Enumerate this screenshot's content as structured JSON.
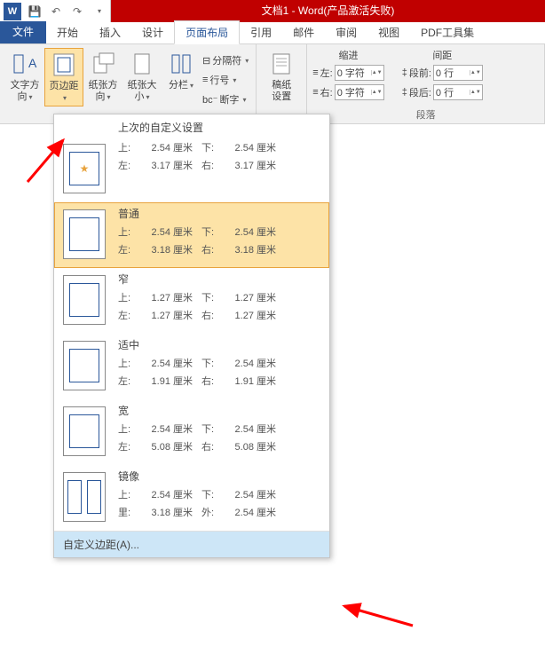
{
  "title": "文档1 - Word(产品激活失败)",
  "qat": {
    "save": "保存",
    "undo": "↶",
    "redo": "↷"
  },
  "tabs": {
    "file": "文件",
    "items": [
      "开始",
      "插入",
      "设计",
      "页面布局",
      "引用",
      "邮件",
      "审阅",
      "视图",
      "PDF工具集"
    ],
    "active_index": 3
  },
  "ribbon": {
    "text_dir": "文字方向",
    "margins": "页边距",
    "orientation": "纸张方向",
    "size": "纸张大小",
    "columns": "分栏",
    "breaks": "分隔符",
    "line_num": "行号",
    "hyphen": "断字",
    "draft": "稿纸",
    "draft2": "设置",
    "indent_group": "缩进",
    "spacing_group": "间距",
    "indent_left": "左:",
    "indent_right": "右:",
    "indent_left_v": "0 字符",
    "indent_right_v": "0 字符",
    "before": "段前:",
    "after": "段后:",
    "before_v": "0 行",
    "after_v": "0 行",
    "para_group": "段落"
  },
  "dropdown": {
    "header": "上次的自定义设置",
    "top": "上:",
    "bottom": "下:",
    "left": "左:",
    "right": "右:",
    "inside": "里:",
    "outside": "外:",
    "custom": "自定义边距(A)...",
    "last": {
      "top": "2.54 厘米",
      "bottom": "2.54 厘米",
      "left": "3.17 厘米",
      "right": "3.17 厘米"
    },
    "presets": [
      {
        "name": "普通",
        "top": "2.54 厘米",
        "bottom": "2.54 厘米",
        "left": "3.18 厘米",
        "right": "3.18 厘米"
      },
      {
        "name": "窄",
        "top": "1.27 厘米",
        "bottom": "1.27 厘米",
        "left": "1.27 厘米",
        "right": "1.27 厘米"
      },
      {
        "name": "适中",
        "top": "2.54 厘米",
        "bottom": "2.54 厘米",
        "left": "1.91 厘米",
        "right": "1.91 厘米"
      },
      {
        "name": "宽",
        "top": "2.54 厘米",
        "bottom": "2.54 厘米",
        "left": "5.08 厘米",
        "right": "5.08 厘米"
      },
      {
        "name": "镜像",
        "top": "2.54 厘米",
        "bottom": "2.54 厘米",
        "left": "3.18 厘米",
        "right": "2.54 厘米",
        "mirror": true
      }
    ]
  }
}
